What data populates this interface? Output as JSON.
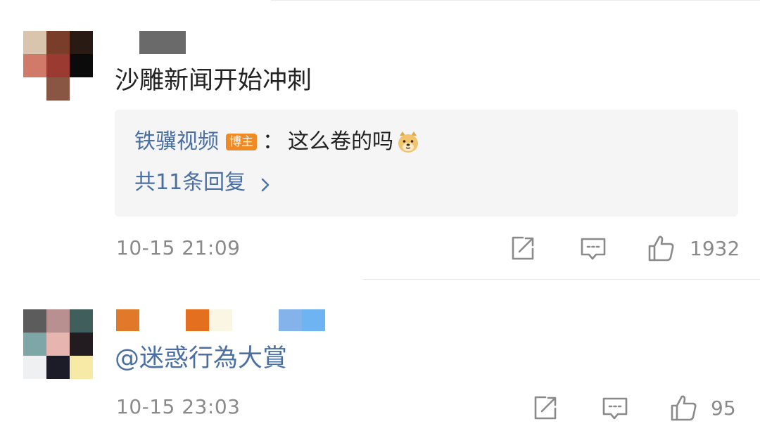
{
  "comments": [
    {
      "text": "沙雕新闻开始冲刺",
      "reply": {
        "author": "铁骥视频",
        "badge": "博主",
        "separator": "：",
        "text": "这么卷的吗",
        "emoji": "doge-emoji"
      },
      "reply_count_label": "共11条回复",
      "time": "10-15 21:09",
      "likes": "1932"
    },
    {
      "text": "@迷惑行為大賞",
      "time": "10-15 23:03",
      "likes": "95"
    }
  ],
  "icons": [
    "share-icon",
    "comment-icon",
    "like-icon",
    "chevron-right-icon",
    "doge-emoji"
  ],
  "colors": {
    "link_blue": "#4a6fa5",
    "badge_orange": "#f08a24",
    "meta_gray": "#8a8a8a",
    "reply_bg": "#f5f5f5"
  }
}
